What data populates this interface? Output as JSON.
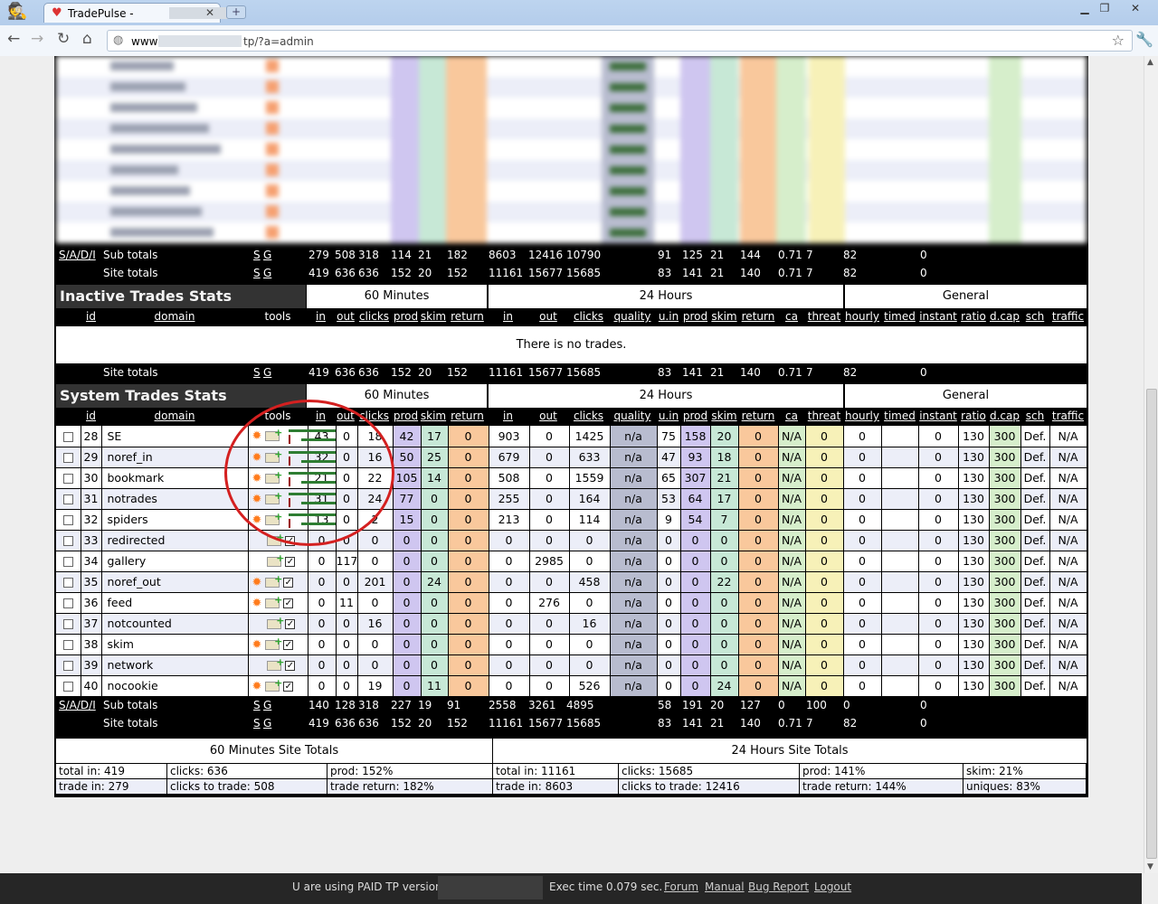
{
  "browser": {
    "tab_title": "TradePulse -",
    "tab_suffix": "-",
    "address_prefix": "www",
    "address_suffix": "tp/?a=admin"
  },
  "columns": {
    "id": "id",
    "domain": "domain",
    "tools": "tools",
    "in": "in",
    "out": "out",
    "clicks": "clicks",
    "prod": "prod",
    "skim": "skim",
    "return": "return",
    "quality": "quality",
    "uin": "u.in",
    "ca": "ca",
    "threat": "threat",
    "hourly": "hourly",
    "timed": "timed",
    "instant": "instant",
    "ratio": "ratio",
    "dcap": "d.cap",
    "sch": "sch",
    "traffic": "traffic"
  },
  "groups": {
    "g60": "60 Minutes",
    "g24": "24 Hours",
    "general": "General"
  },
  "active_totals": {
    "sub_label": "Sub totals",
    "site_label": "Site totals",
    "sadi": "S/A/D/I",
    "s": "S",
    "g": "G",
    "sub": [
      "279",
      "508",
      "318",
      "114",
      "21",
      "182",
      "8603",
      "12416",
      "10790",
      "",
      "91",
      "125",
      "21",
      "144",
      "0.71",
      "7",
      "82",
      "",
      "0"
    ],
    "site": [
      "419",
      "636",
      "636",
      "152",
      "20",
      "152",
      "11161",
      "15677",
      "15685",
      "",
      "83",
      "141",
      "21",
      "140",
      "0.71",
      "7",
      "82",
      "",
      "0"
    ]
  },
  "inactive": {
    "title": "Inactive Trades Stats",
    "empty_msg": "There is no trades.",
    "site_label": "Site totals",
    "s": "S",
    "g": "G",
    "site": [
      "419",
      "636",
      "636",
      "152",
      "20",
      "152",
      "11161",
      "15677",
      "15685",
      "",
      "83",
      "141",
      "21",
      "140",
      "0.71",
      "7",
      "82",
      "",
      "0"
    ]
  },
  "system": {
    "title": "System Trades Stats",
    "rows": [
      {
        "id": "28",
        "domain": "SE",
        "gear": true,
        "bars": true,
        "v": [
          "43",
          "0",
          "18",
          "42",
          "17",
          "0",
          "903",
          "0",
          "1425",
          "n/a",
          "75",
          "158",
          "20",
          "0",
          "N/A",
          "0",
          "0",
          "",
          "0",
          "130",
          "300",
          "Def.",
          "N/A"
        ]
      },
      {
        "id": "29",
        "domain": "noref_in",
        "gear": true,
        "bars": true,
        "v": [
          "32",
          "0",
          "16",
          "50",
          "25",
          "0",
          "679",
          "0",
          "633",
          "n/a",
          "47",
          "93",
          "18",
          "0",
          "N/A",
          "0",
          "0",
          "",
          "0",
          "130",
          "300",
          "Def.",
          "N/A"
        ]
      },
      {
        "id": "30",
        "domain": "bookmark",
        "gear": true,
        "bars": true,
        "v": [
          "21",
          "0",
          "22",
          "105",
          "14",
          "0",
          "508",
          "0",
          "1559",
          "n/a",
          "65",
          "307",
          "21",
          "0",
          "N/A",
          "0",
          "0",
          "",
          "0",
          "130",
          "300",
          "Def.",
          "N/A"
        ]
      },
      {
        "id": "31",
        "domain": "notrades",
        "gear": true,
        "bars": true,
        "v": [
          "31",
          "0",
          "24",
          "77",
          "0",
          "0",
          "255",
          "0",
          "164",
          "n/a",
          "53",
          "64",
          "17",
          "0",
          "N/A",
          "0",
          "0",
          "",
          "0",
          "130",
          "300",
          "Def.",
          "N/A"
        ]
      },
      {
        "id": "32",
        "domain": "spiders",
        "gear": true,
        "bars": true,
        "v": [
          "13",
          "0",
          "2",
          "15",
          "0",
          "0",
          "213",
          "0",
          "114",
          "n/a",
          "9",
          "54",
          "7",
          "0",
          "N/A",
          "0",
          "0",
          "",
          "0",
          "130",
          "300",
          "Def.",
          "N/A"
        ]
      },
      {
        "id": "33",
        "domain": "redirected",
        "gear": false,
        "bars": false,
        "v": [
          "0",
          "0",
          "0",
          "0",
          "0",
          "0",
          "0",
          "0",
          "0",
          "n/a",
          "0",
          "0",
          "0",
          "0",
          "N/A",
          "0",
          "0",
          "",
          "0",
          "130",
          "300",
          "Def.",
          "N/A"
        ]
      },
      {
        "id": "34",
        "domain": "gallery",
        "gear": false,
        "bars": false,
        "v": [
          "0",
          "117",
          "0",
          "0",
          "0",
          "0",
          "0",
          "2985",
          "0",
          "n/a",
          "0",
          "0",
          "0",
          "0",
          "N/A",
          "0",
          "0",
          "",
          "0",
          "130",
          "300",
          "Def.",
          "N/A"
        ]
      },
      {
        "id": "35",
        "domain": "noref_out",
        "gear": true,
        "bars": false,
        "v": [
          "0",
          "0",
          "201",
          "0",
          "24",
          "0",
          "0",
          "0",
          "458",
          "n/a",
          "0",
          "0",
          "22",
          "0",
          "N/A",
          "0",
          "0",
          "",
          "0",
          "130",
          "300",
          "Def.",
          "N/A"
        ]
      },
      {
        "id": "36",
        "domain": "feed",
        "gear": true,
        "bars": false,
        "v": [
          "0",
          "11",
          "0",
          "0",
          "0",
          "0",
          "0",
          "276",
          "0",
          "n/a",
          "0",
          "0",
          "0",
          "0",
          "N/A",
          "0",
          "0",
          "",
          "0",
          "130",
          "300",
          "Def.",
          "N/A"
        ]
      },
      {
        "id": "37",
        "domain": "notcounted",
        "gear": false,
        "bars": false,
        "v": [
          "0",
          "0",
          "16",
          "0",
          "0",
          "0",
          "0",
          "0",
          "16",
          "n/a",
          "0",
          "0",
          "0",
          "0",
          "N/A",
          "0",
          "0",
          "",
          "0",
          "130",
          "300",
          "Def.",
          "N/A"
        ]
      },
      {
        "id": "38",
        "domain": "skim",
        "gear": true,
        "bars": false,
        "v": [
          "0",
          "0",
          "0",
          "0",
          "0",
          "0",
          "0",
          "0",
          "0",
          "n/a",
          "0",
          "0",
          "0",
          "0",
          "N/A",
          "0",
          "0",
          "",
          "0",
          "130",
          "300",
          "Def.",
          "N/A"
        ]
      },
      {
        "id": "39",
        "domain": "network",
        "gear": false,
        "bars": false,
        "v": [
          "0",
          "0",
          "0",
          "0",
          "0",
          "0",
          "0",
          "0",
          "0",
          "n/a",
          "0",
          "0",
          "0",
          "0",
          "N/A",
          "0",
          "0",
          "",
          "0",
          "130",
          "300",
          "Def.",
          "N/A"
        ]
      },
      {
        "id": "40",
        "domain": "nocookie",
        "gear": true,
        "bars": false,
        "v": [
          "0",
          "0",
          "19",
          "0",
          "11",
          "0",
          "0",
          "0",
          "526",
          "n/a",
          "0",
          "0",
          "24",
          "0",
          "N/A",
          "0",
          "0",
          "",
          "0",
          "130",
          "300",
          "Def.",
          "N/A"
        ]
      }
    ],
    "sub_label": "Sub totals",
    "site_label": "Site totals",
    "sadi": "S/A/D/I",
    "s": "S",
    "g": "G",
    "sub": [
      "140",
      "128",
      "318",
      "227",
      "19",
      "91",
      "2558",
      "3261",
      "4895",
      "",
      "58",
      "191",
      "20",
      "127",
      "0",
      "100",
      "0",
      "",
      "0"
    ],
    "site": [
      "419",
      "636",
      "636",
      "152",
      "20",
      "152",
      "11161",
      "15677",
      "15685",
      "",
      "83",
      "141",
      "21",
      "140",
      "0.71",
      "7",
      "82",
      "",
      "0"
    ]
  },
  "site_totals": {
    "h60": "60 Minutes Site Totals",
    "h24": "24 Hours Site Totals",
    "r1": [
      "total in: 419",
      "clicks: 636",
      "prod: 152%",
      "total in: 11161",
      "clicks: 15685",
      "prod: 141%",
      "skim: 21%"
    ],
    "r2": [
      "trade in: 279",
      "clicks to trade: 508",
      "trade return: 182%",
      "trade in: 8603",
      "clicks to trade: 12416",
      "trade return: 144%",
      "uniques: 83%"
    ]
  },
  "footer": {
    "paid": "U are using PAID TP version",
    "exec": "Exec time 0.079 sec.",
    "forum": "Forum",
    "manual": "Manual",
    "bug": "Bug Report",
    "logout": "Logout"
  },
  "colors": {
    "row_a": "#ffffff",
    "row_b": "#eceef8",
    "prod": "#cfc6f0",
    "skim": "#c7e8d6",
    "return": "#f9c89c",
    "quality": "#b8bccf",
    "ca": "#d6eecb",
    "threat": "#f7f1b8",
    "dcap": "#d6eecb",
    "gear": "#ff7b1c",
    "annotation": "#d42020"
  }
}
